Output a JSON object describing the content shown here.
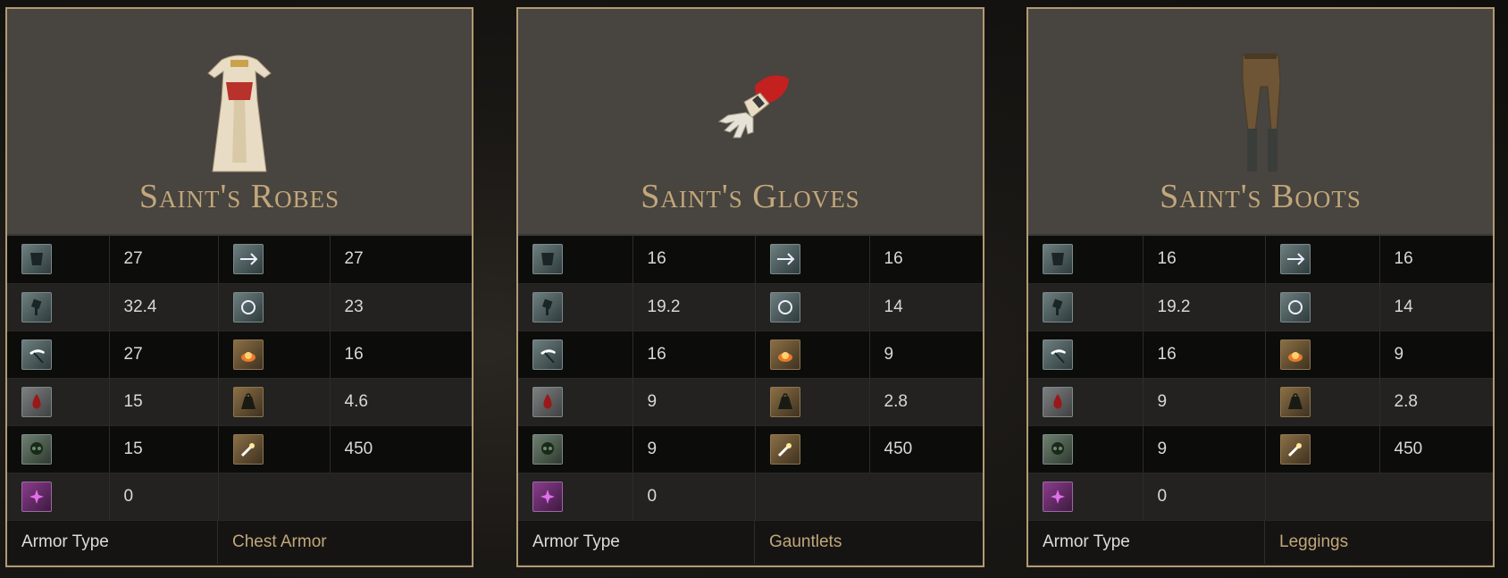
{
  "cards": [
    {
      "name": "Saint's Robes",
      "rows": [
        [
          "27",
          "27"
        ],
        [
          "32.4",
          "23"
        ],
        [
          "27",
          "16"
        ],
        [
          "15",
          "4.6"
        ],
        [
          "15",
          "450"
        ]
      ],
      "last": "0",
      "armor_type_label": "Armor Type",
      "armor_type": "Chest Armor"
    },
    {
      "name": "Saint's Gloves",
      "rows": [
        [
          "16",
          "16"
        ],
        [
          "19.2",
          "14"
        ],
        [
          "16",
          "9"
        ],
        [
          "9",
          "2.8"
        ],
        [
          "9",
          "450"
        ]
      ],
      "last": "0",
      "armor_type_label": "Armor Type",
      "armor_type": "Gauntlets"
    },
    {
      "name": "Saint's Boots",
      "rows": [
        [
          "16",
          "16"
        ],
        [
          "19.2",
          "14"
        ],
        [
          "16",
          "9"
        ],
        [
          "9",
          "2.8"
        ],
        [
          "9",
          "450"
        ]
      ],
      "last": "0",
      "armor_type_label": "Armor Type",
      "armor_type": "Leggings"
    }
  ],
  "icons": {
    "left": [
      "armor-icon",
      "strike-icon",
      "slash-icon",
      "bleed-icon",
      "poison-icon",
      "magic-icon"
    ],
    "right": [
      "pierce-icon",
      "magic-swirl-icon",
      "fire-icon",
      "weight-icon",
      "durability-icon"
    ]
  },
  "colors": {
    "title": "#c2a77a",
    "border": "#b39a73",
    "header_bg": "#48443f"
  }
}
